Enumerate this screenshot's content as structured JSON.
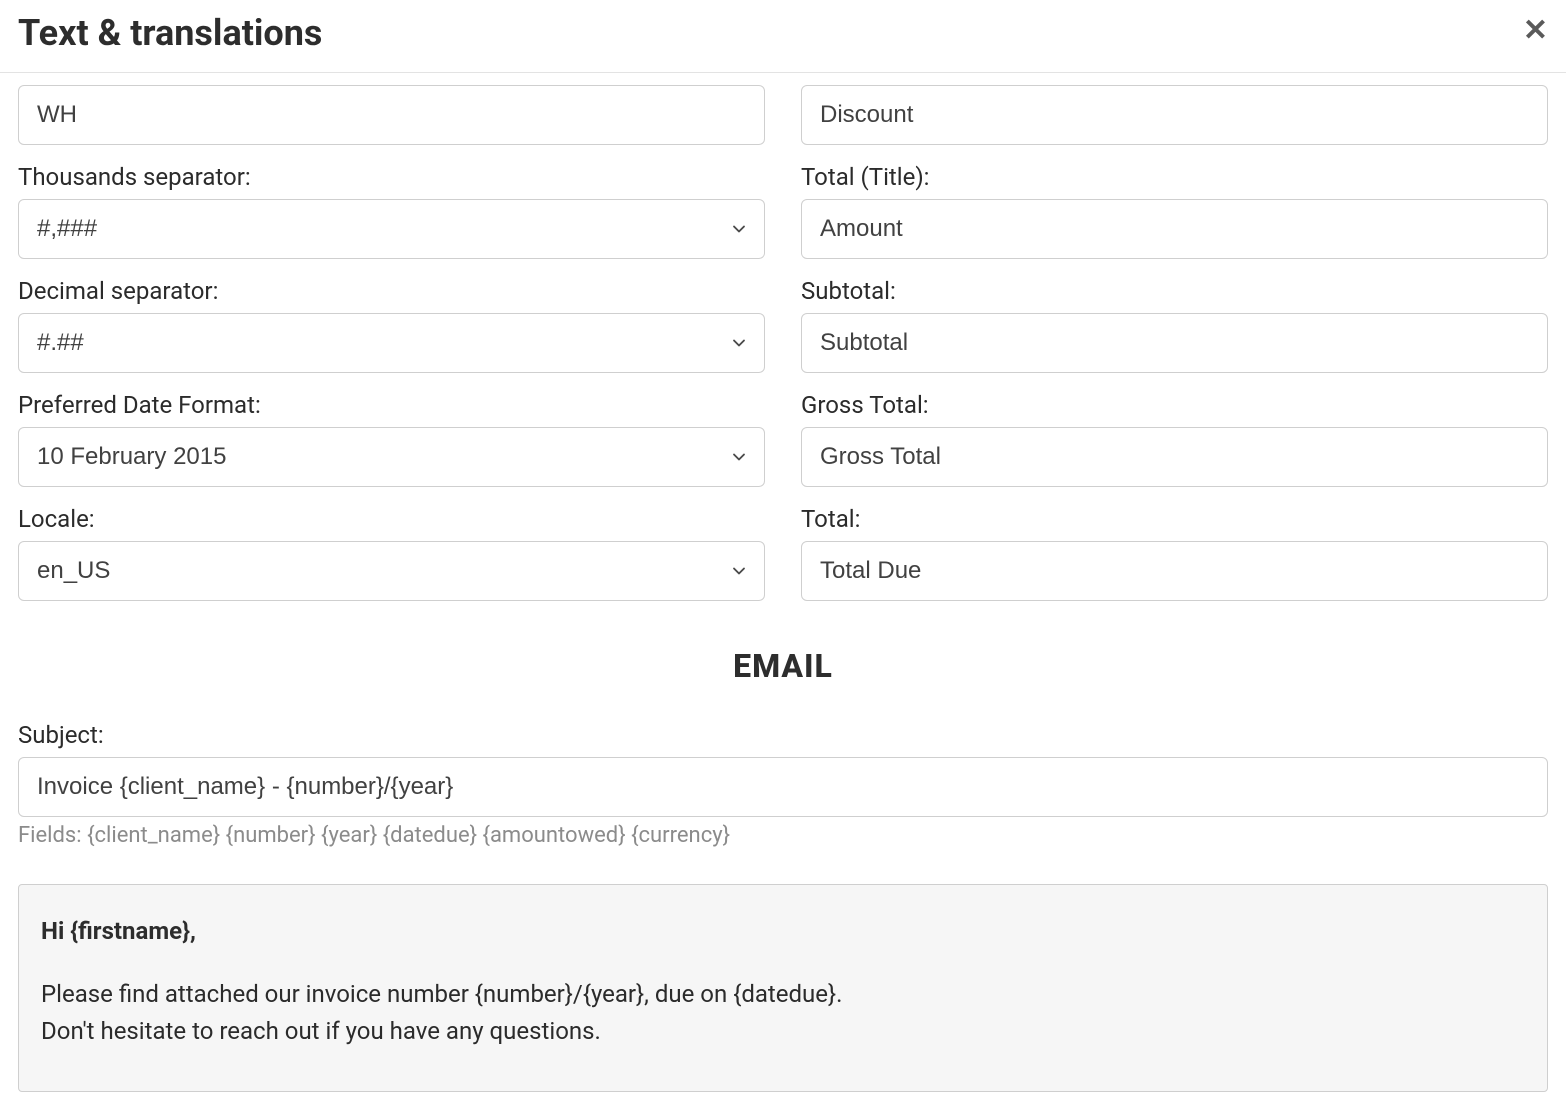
{
  "header": {
    "title": "Text & translations"
  },
  "left": {
    "wh_value": "WH",
    "thousands_label": "Thousands separator:",
    "thousands_value": "#,###",
    "decimal_label": "Decimal separator:",
    "decimal_value": "#.##",
    "dateformat_label": "Preferred Date Format:",
    "dateformat_value": "10 February 2015",
    "locale_label": "Locale:",
    "locale_value": "en_US"
  },
  "right": {
    "discount_value": "Discount",
    "total_title_label": "Total (Title):",
    "total_title_value": "Amount",
    "subtotal_label": "Subtotal:",
    "subtotal_value": "Subtotal",
    "gross_total_label": "Gross Total:",
    "gross_total_value": "Gross Total",
    "total_label": "Total:",
    "total_value": "Total Due"
  },
  "email": {
    "section_title": "EMAIL",
    "subject_label": "Subject:",
    "subject_value": "Invoice {client_name} - {number}/{year}",
    "fields_hint": "Fields: {client_name} {number} {year} {datedue} {amountowed} {currency}",
    "body_greeting": "Hi {firstname},",
    "body_line1": "Please find attached our invoice number {number}/{year}, due on {datedue}.",
    "body_line2": "Don't hesitate to reach out if you have any questions."
  }
}
